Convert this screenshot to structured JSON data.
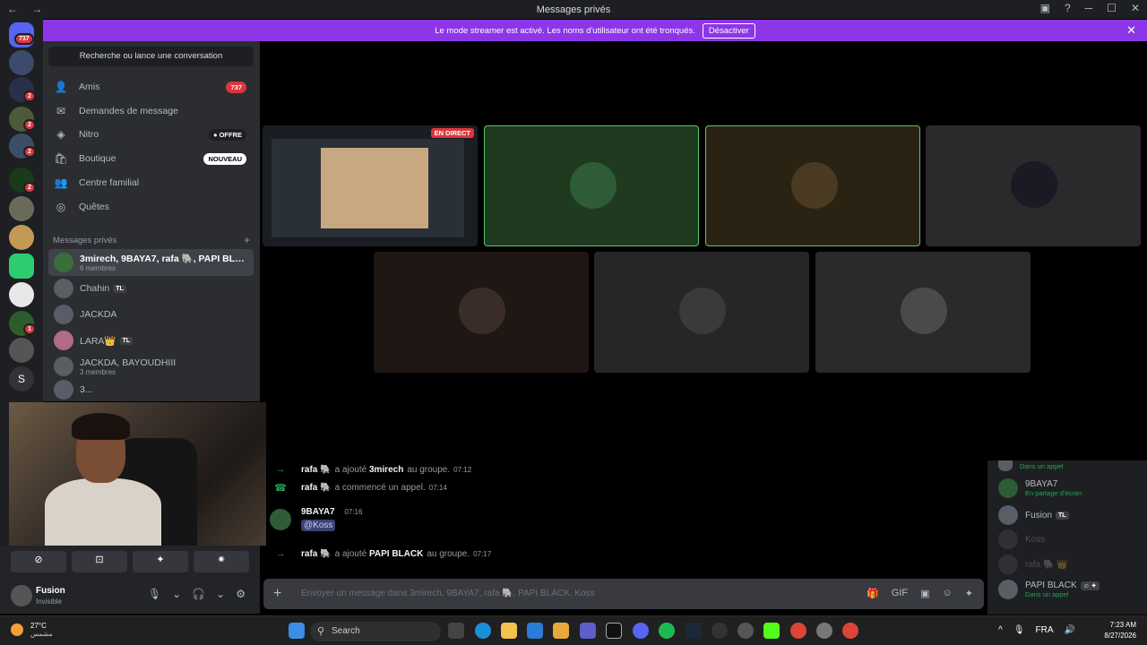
{
  "window": {
    "title": "Messages privés",
    "nav": "← →",
    "controls": [
      "▣",
      "?",
      "─",
      "☐",
      "✕"
    ]
  },
  "banner": {
    "text": "Le mode streamer est activé. Les noms d'utilisateur ont été tronqués.",
    "button": "Désactiver",
    "close": "✕"
  },
  "rail": {
    "home_badge": "737",
    "badges": [
      "2",
      "2",
      "2",
      "2",
      "1"
    ],
    "s_label": "S"
  },
  "sidebar": {
    "search": "Recherche ou lance une conversation",
    "nav": [
      {
        "label": "Amis",
        "icon": "friends-icon",
        "glyph": "👤",
        "pill": "737"
      },
      {
        "label": "Demandes de message",
        "icon": "mail-icon",
        "glyph": "✉",
        "pill": ""
      },
      {
        "label": "Nitro",
        "icon": "nitro-icon",
        "glyph": "◈",
        "pill": "● OFFRE"
      },
      {
        "label": "Boutique",
        "icon": "shop-icon",
        "glyph": "🛍",
        "pill": "NOUVEAU"
      },
      {
        "label": "Centre familial",
        "icon": "family-icon",
        "glyph": "👥",
        "pill": ""
      },
      {
        "label": "Quêtes",
        "icon": "quests-icon",
        "glyph": "◎",
        "pill": ""
      }
    ],
    "section_label": "Messages privés",
    "section_plus": "+",
    "dms": [
      {
        "name": "3mirech, 9BAYA7, rafa 🐘, PAPI BLACK,...",
        "sub": "6 membres",
        "tag": ""
      },
      {
        "name": "Chahin",
        "sub": "",
        "tag": "TL"
      },
      {
        "name": "JACKDA",
        "sub": "",
        "tag": ""
      },
      {
        "name": "LARA👑",
        "sub": "",
        "tag": "TL"
      },
      {
        "name": "JACKDA, BAYOUDHIII",
        "sub": "3 membres",
        "tag": ""
      },
      {
        "name": "3...",
        "sub": "",
        "tag": ""
      }
    ]
  },
  "rtc_buttons": [
    "⊘",
    "⊡",
    "✦",
    "✷"
  ],
  "user": {
    "name": "Fusion",
    "status": "Invisible",
    "controls": [
      "🎙",
      "⌄",
      "🎧",
      "⌄",
      "⚙"
    ]
  },
  "stage": {
    "live_label": "EN DIRECT"
  },
  "messages": [
    {
      "icon": "→",
      "author": "rafa 🐘",
      "text": "a ajouté",
      "target": "3mirech",
      "suffix": "au groupe.",
      "time": "07:12"
    },
    {
      "icon": "☎",
      "author": "rafa 🐘",
      "text": "a commencé un appel.",
      "target": "",
      "suffix": "",
      "time": "07:14"
    },
    {
      "author": "9BAYA7",
      "time": "07:16",
      "mention": "@Koss"
    },
    {
      "icon": "→",
      "author": "rafa 🐘",
      "text": "a ajouté",
      "target": "PAPI BLACK",
      "suffix": "au groupe.",
      "time": "07:17"
    }
  ],
  "composer": {
    "plus": "+",
    "placeholder": "Envoyer un message dans 3mirech, 9BAYA7, rafa 🐘, PAPI BLACK, Koss",
    "tools": [
      "🎁",
      "GIF",
      "▣",
      "☺",
      "✦"
    ]
  },
  "members": [
    {
      "name": "",
      "status": "Dans un appel"
    },
    {
      "name": "9BAYA7",
      "status": "En partage d'écran"
    },
    {
      "name": "Fusion",
      "status": "",
      "tag": "TL"
    },
    {
      "name": "Koss",
      "status": "",
      "dim": true
    },
    {
      "name": "rafa 🐘 👑",
      "status": "",
      "dim": true
    },
    {
      "name": "PAPI BLACK",
      "status": "Dans un appel",
      "tag": "☺ ✦"
    }
  ],
  "taskbar": {
    "temp": "27°C",
    "condition": "مشمس",
    "search": "Search",
    "search_icon": "⚲",
    "lang": "FRA",
    "time": "7:23 AM",
    "date": "8/27/2026",
    "tray_icons": [
      "^",
      "🎙",
      "🔊"
    ]
  }
}
